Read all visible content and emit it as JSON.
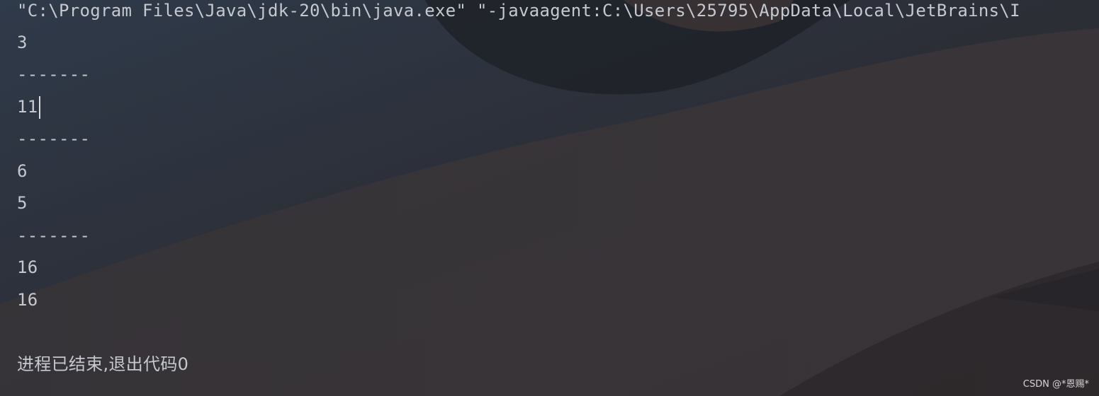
{
  "console": {
    "command_line": "\"C:\\Program Files\\Java\\jdk-20\\bin\\java.exe\" \"-javaagent:C:\\Users\\25795\\AppData\\Local\\JetBrains\\I",
    "output_lines": [
      "3",
      "-------",
      "11",
      "-------",
      "6",
      "5",
      "-------",
      "16",
      "16"
    ],
    "exit_message": "进程已结束,退出代码0"
  },
  "watermark": "CSDN @*恩赐*",
  "colors": {
    "text": "#c5c8cf",
    "background": "#2b2d33"
  }
}
